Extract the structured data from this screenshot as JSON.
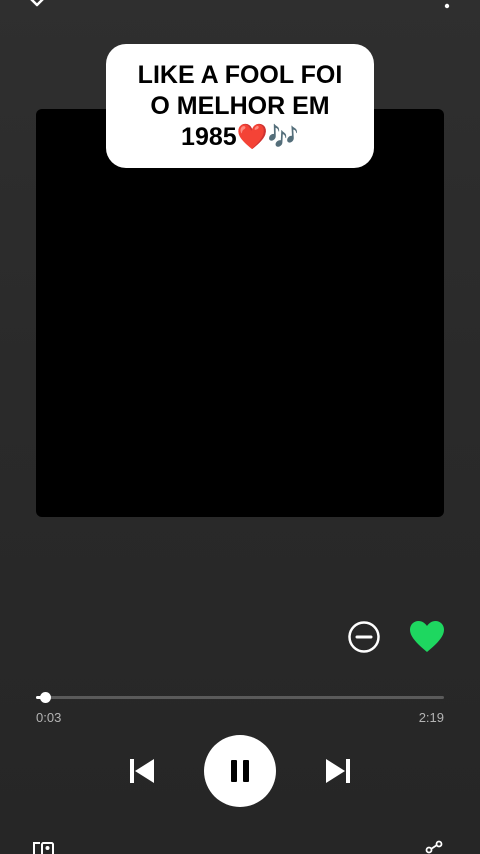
{
  "caption": {
    "text": "LIKE A FOOL FOI\nO MELHOR EM\n1985",
    "emoji": "❤️🎶"
  },
  "player": {
    "progress_fraction": 0.022,
    "elapsed": "0:03",
    "total": "2:19",
    "liked": true
  },
  "icons": {
    "collapse": "chevron-down-icon",
    "more": "more-vertical-icon",
    "remove": "minus-circle-icon",
    "like": "heart-icon",
    "previous": "skip-previous-icon",
    "pause": "pause-icon",
    "next": "skip-next-icon",
    "devices": "connect-device-icon",
    "share": "share-icon"
  },
  "colors": {
    "accent_green": "#1ed760",
    "background": "#2a2a2a",
    "cover": "#000000",
    "text_secondary": "#b3b3b3"
  }
}
